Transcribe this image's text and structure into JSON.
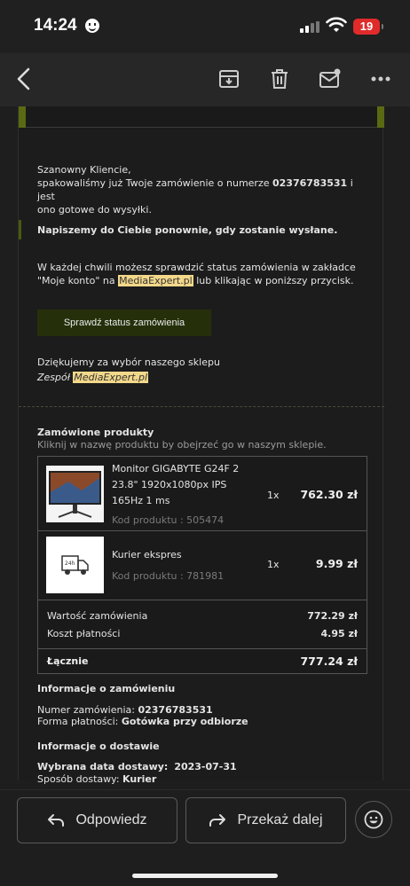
{
  "status_bar": {
    "time": "14:24",
    "battery": "19"
  },
  "email": {
    "greeting": "Szanowny Kliencie,",
    "packed_prefix": "spakowaliśmy już Twoje zamówienie o numerze ",
    "order_number": "02376783531",
    "packed_suffix_1": " i jest",
    "packed_suffix_2": "ono gotowe do wysyłki.",
    "notify": "Napiszemy do Ciebie ponownie, gdy zostanie wysłane.",
    "check_line1": "W każdej chwili możesz sprawdzić status zamówienia w zakładce",
    "check_line2_a": "\"Moje konto\" na ",
    "store_link": "MediaExpert.pl",
    "check_line2_b": " lub klikając w poniższy przycisk.",
    "status_button": "Sprawdź status zamówienia",
    "thanks": "Dziękujemy za wybór naszego sklepu",
    "team_prefix": "Zespół ",
    "team_link": "MediaExpert.pl",
    "ordered_title": "Zamówione produkty",
    "ordered_sub": "Kliknij w nazwę produktu by obejrzeć go w naszym sklepie.",
    "products": [
      {
        "name_1": "Monitor GIGABYTE G24F 2",
        "name_2": "23.8\" 1920x1080px IPS",
        "name_3": "165Hz 1 ms",
        "code": "Kod produktu : 505474",
        "qty": "1x",
        "price": "762.30 zł"
      },
      {
        "name_1": "Kurier ekspres",
        "code": "Kod produktu : 781981",
        "qty": "1x",
        "price": "9.99 zł",
        "icon_text": "24h"
      }
    ],
    "summary": [
      {
        "label": "Wartość zamówienia",
        "value": "772.29 zł"
      },
      {
        "label": "Koszt płatności",
        "value": "4.95 zł"
      }
    ],
    "total_label": "Łącznie",
    "total_value": "777.24 zł",
    "order_info_title": "Informacje o zamówieniu",
    "order_no_label": "Numer zamówienia: ",
    "order_no_value": "02376783531",
    "payment_label": "Forma płatności: ",
    "payment_value": "Gotówka przy odbiorze",
    "delivery_title": "Informacje o dostawie",
    "delivery_date_label": "Wybrana data dostawy:",
    "delivery_date_value": "2023-07-31",
    "delivery_method_label": "Sposób dostawy: ",
    "delivery_method_value": "Kurier"
  },
  "actions": {
    "reply": "Odpowiedz",
    "forward": "Przekaż dalej"
  },
  "colors": {
    "button_bg": "#25300b",
    "highlight": "#f3d88a",
    "battery": "#e02b2b"
  }
}
